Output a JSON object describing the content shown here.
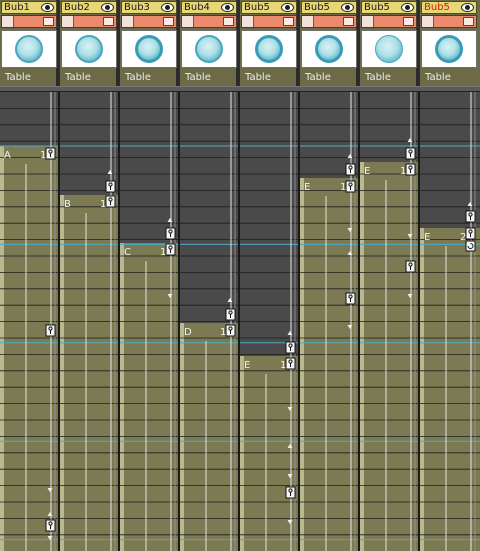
{
  "tracks": [
    {
      "name": "Bub1",
      "label": "Table",
      "cell": "A",
      "count": "1",
      "active": false
    },
    {
      "name": "Bub2",
      "label": "Table",
      "cell": "B",
      "count": "1",
      "active": false
    },
    {
      "name": "Bub3",
      "label": "Table",
      "cell": "C",
      "count": "1",
      "active": false
    },
    {
      "name": "Bub4",
      "label": "Table",
      "cell": "D",
      "count": "1",
      "active": false
    },
    {
      "name": "Bub5",
      "label": "Table",
      "cell": "E",
      "count": "1",
      "active": false
    },
    {
      "name": "Bub5",
      "label": "Table",
      "cell": "E",
      "count": "1",
      "active": false
    },
    {
      "name": "Bub5",
      "label": "Table",
      "cell": "E",
      "count": "1",
      "active": false
    },
    {
      "name": "Bub5",
      "label": "Table",
      "cell": "E",
      "count": "2",
      "active": true
    }
  ],
  "colors": {
    "cell_fill": "#7b7a52",
    "empty_fill": "#4a4a4a",
    "active_name": "#d41a0c",
    "selection_line": "#4fa9c4"
  }
}
